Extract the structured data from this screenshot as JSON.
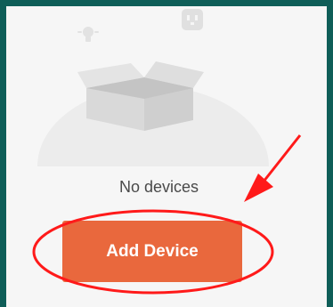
{
  "empty_state": {
    "message": "No devices",
    "illustration_icons": [
      "lightbulb-icon",
      "smart-plug-icon",
      "open-box-icon"
    ]
  },
  "actions": {
    "add_device_label": "Add Device"
  },
  "colors": {
    "frame": "#0f5e58",
    "panel": "#f6f6f6",
    "button": "#e9683d",
    "annotation": "#ff1a1a"
  }
}
